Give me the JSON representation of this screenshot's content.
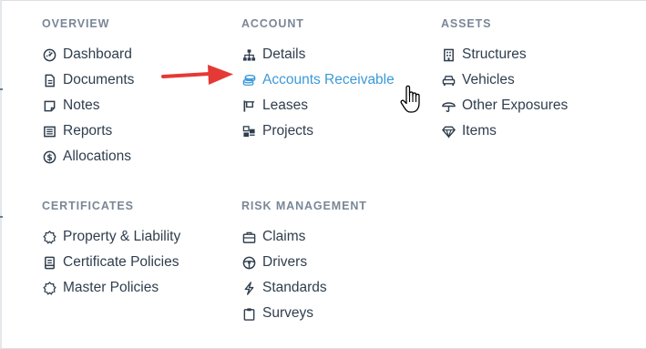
{
  "menu": {
    "overview": {
      "heading": "OVERVIEW",
      "items": [
        {
          "label": "Dashboard",
          "icon": "dashboard-icon"
        },
        {
          "label": "Documents",
          "icon": "document-icon"
        },
        {
          "label": "Notes",
          "icon": "note-icon"
        },
        {
          "label": "Reports",
          "icon": "report-icon"
        },
        {
          "label": "Allocations",
          "icon": "dollar-icon"
        }
      ]
    },
    "account": {
      "heading": "ACCOUNT",
      "items": [
        {
          "label": "Details",
          "icon": "sitemap-icon"
        },
        {
          "label": "Accounts Receivable",
          "icon": "coins-icon",
          "active": true
        },
        {
          "label": "Leases",
          "icon": "lease-icon"
        },
        {
          "label": "Projects",
          "icon": "projects-icon"
        }
      ]
    },
    "assets": {
      "heading": "ASSETS",
      "items": [
        {
          "label": "Structures",
          "icon": "building-icon"
        },
        {
          "label": "Vehicles",
          "icon": "car-icon"
        },
        {
          "label": "Other Exposures",
          "icon": "umbrella-icon"
        },
        {
          "label": "Items",
          "icon": "gem-icon"
        }
      ]
    },
    "certificates": {
      "heading": "CERTIFICATES",
      "items": [
        {
          "label": "Property & Liability",
          "icon": "certificate-icon"
        },
        {
          "label": "Certificate Policies",
          "icon": "policy-icon"
        },
        {
          "label": "Master Policies",
          "icon": "certificate-icon"
        }
      ]
    },
    "risk_management": {
      "heading": "RISK MANAGEMENT",
      "items": [
        {
          "label": "Claims",
          "icon": "briefcase-icon"
        },
        {
          "label": "Drivers",
          "icon": "steering-wheel-icon"
        },
        {
          "label": "Standards",
          "icon": "bolt-icon"
        },
        {
          "label": "Surveys",
          "icon": "clipboard-icon"
        }
      ]
    }
  },
  "colors": {
    "text": "#2f3e4e",
    "heading": "#7a8797",
    "active": "#3b9ad8",
    "arrow": "#e53935"
  }
}
